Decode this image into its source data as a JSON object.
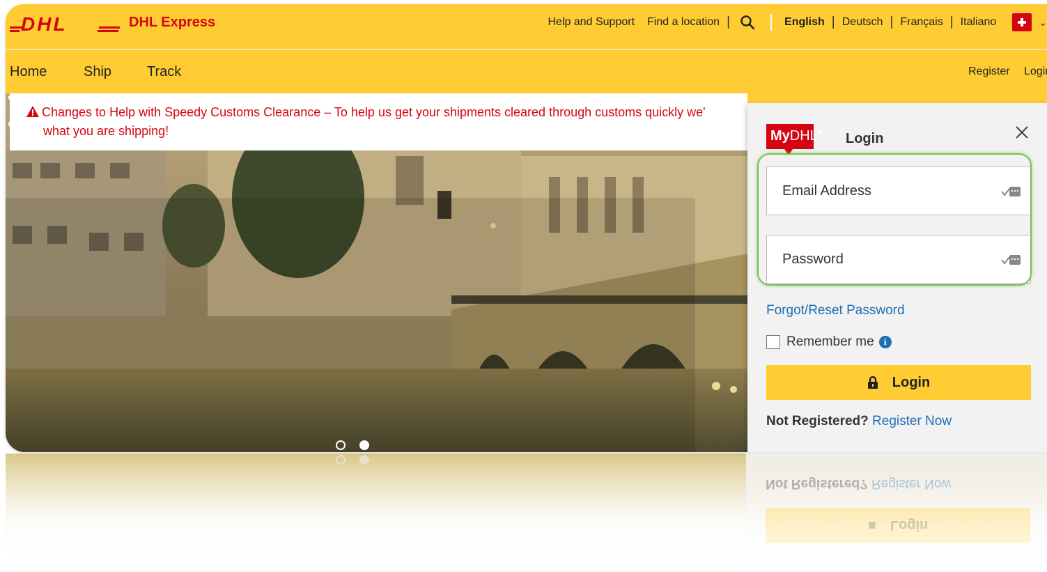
{
  "brand": {
    "logo_text": "DHL",
    "name": "DHL Express"
  },
  "topnav": {
    "help": "Help and Support",
    "find_location": "Find a location",
    "languages": [
      "English",
      "Deutsch",
      "Français",
      "Italiano"
    ],
    "active_language": "English",
    "search_icon": "search-icon",
    "country_flag": "swiss-flag-icon"
  },
  "mainnav": {
    "home": "Home",
    "ship": "Ship",
    "track": "Track",
    "register": "Register",
    "login": "Login"
  },
  "alert": {
    "line1": "Changes to Help with Speedy Customs Clearance – To help us get your shipments cleared through customs quickly we'",
    "line2": "what you are shipping!"
  },
  "login_panel": {
    "badge_bold": "My",
    "badge_light": "DHL",
    "badge_plus": "+",
    "title": "Login",
    "email_placeholder": "Email Address",
    "password_placeholder": "Password",
    "forgot": "Forgot/Reset Password",
    "remember": "Remember me",
    "button": "Login",
    "not_registered": "Not Registered?",
    "register_now": "Register Now"
  },
  "carousel": {
    "slides": 2,
    "active": 2
  },
  "colors": {
    "dhl_yellow": "#ffcc33",
    "dhl_red": "#d40511",
    "link_blue": "#1f6fb5",
    "focus_green": "#74c04a"
  }
}
